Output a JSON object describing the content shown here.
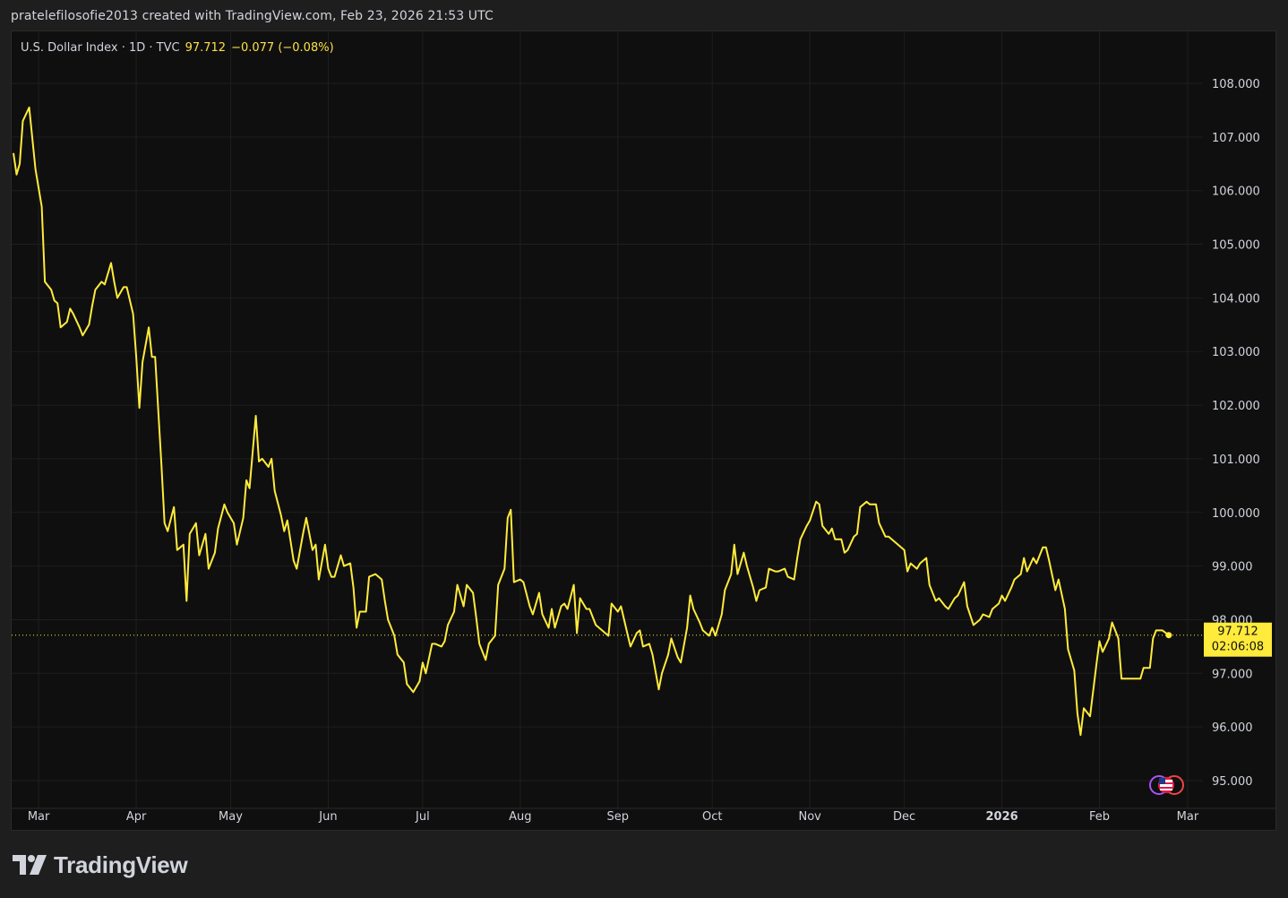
{
  "header": {
    "credit": "pratelefilosofie2013 created with TradingView.com, Feb 23, 2026 21:53 UTC"
  },
  "legend": {
    "symbol": "U.S. Dollar Index · 1D · TVC",
    "last": "97.712",
    "change": "−0.077 (−0.08%)"
  },
  "price_tag": {
    "price": "97.712",
    "countdown": "02:06:08"
  },
  "footer": {
    "brand": "TradingView"
  },
  "colors": {
    "line": "#ffeb3b",
    "background": "#0f0f0f",
    "grid": "#1f1f1f",
    "axis_text": "#d1d4dc"
  },
  "icons": [
    "us-flag-icon",
    "event-marker-icon"
  ],
  "chart_data": {
    "type": "line",
    "title": "U.S. Dollar Index · 1D · TVC",
    "xlabel": "",
    "ylabel": "",
    "ylim": [
      94.5,
      109.0
    ],
    "y_ticks": [
      "108.000",
      "107.000",
      "106.000",
      "105.000",
      "104.000",
      "103.000",
      "102.000",
      "101.000",
      "100.000",
      "99.000",
      "98.000",
      "97.000",
      "96.000",
      "95.000"
    ],
    "x_ticks": [
      "Mar",
      "Apr",
      "May",
      "Jun",
      "Jul",
      "Aug",
      "Sep",
      "Oct",
      "Nov",
      "Dec",
      "2026",
      "Feb",
      "Mar"
    ],
    "x_tick_dates": [
      "2025-03-01",
      "2025-04-01",
      "2025-05-01",
      "2025-06-01",
      "2025-07-01",
      "2025-08-01",
      "2025-09-01",
      "2025-10-01",
      "2025-11-01",
      "2025-12-01",
      "2026-01-01",
      "2026-02-01",
      "2026-03-01"
    ],
    "x_range": [
      "2025-02-21",
      "2026-03-05"
    ],
    "grid": true,
    "legend_position": "top-left",
    "last_value": 97.712,
    "series": [
      {
        "name": "U.S. Dollar Index",
        "points": [
          [
            "2025-02-21",
            106.7
          ],
          [
            "2025-02-22",
            106.3
          ],
          [
            "2025-02-23",
            106.5
          ],
          [
            "2025-02-24",
            107.3
          ],
          [
            "2025-02-26",
            107.55
          ],
          [
            "2025-02-28",
            106.4
          ],
          [
            "2025-03-02",
            105.7
          ],
          [
            "2025-03-03",
            104.3
          ],
          [
            "2025-03-05",
            104.15
          ],
          [
            "2025-03-06",
            103.95
          ],
          [
            "2025-03-07",
            103.9
          ],
          [
            "2025-03-08",
            103.45
          ],
          [
            "2025-03-10",
            103.55
          ],
          [
            "2025-03-11",
            103.8
          ],
          [
            "2025-03-12",
            103.7
          ],
          [
            "2025-03-14",
            103.45
          ],
          [
            "2025-03-15",
            103.3
          ],
          [
            "2025-03-17",
            103.5
          ],
          [
            "2025-03-18",
            103.85
          ],
          [
            "2025-03-19",
            104.15
          ],
          [
            "2025-03-21",
            104.3
          ],
          [
            "2025-03-22",
            104.25
          ],
          [
            "2025-03-24",
            104.65
          ],
          [
            "2025-03-25",
            104.3
          ],
          [
            "2025-03-26",
            104.0
          ],
          [
            "2025-03-28",
            104.2
          ],
          [
            "2025-03-29",
            104.2
          ],
          [
            "2025-03-31",
            103.7
          ],
          [
            "2025-04-01",
            102.9
          ],
          [
            "2025-04-02",
            101.95
          ],
          [
            "2025-04-03",
            102.8
          ],
          [
            "2025-04-05",
            103.45
          ],
          [
            "2025-04-06",
            102.9
          ],
          [
            "2025-04-07",
            102.9
          ],
          [
            "2025-04-09",
            100.9
          ],
          [
            "2025-04-10",
            99.8
          ],
          [
            "2025-04-11",
            99.65
          ],
          [
            "2025-04-13",
            100.1
          ],
          [
            "2025-04-14",
            99.3
          ],
          [
            "2025-04-16",
            99.4
          ],
          [
            "2025-04-17",
            98.35
          ],
          [
            "2025-04-18",
            99.6
          ],
          [
            "2025-04-20",
            99.8
          ],
          [
            "2025-04-21",
            99.2
          ],
          [
            "2025-04-23",
            99.6
          ],
          [
            "2025-04-24",
            98.95
          ],
          [
            "2025-04-26",
            99.25
          ],
          [
            "2025-04-27",
            99.7
          ],
          [
            "2025-04-29",
            100.15
          ],
          [
            "2025-04-30",
            100.0
          ],
          [
            "2025-05-02",
            99.8
          ],
          [
            "2025-05-03",
            99.4
          ],
          [
            "2025-05-05",
            99.9
          ],
          [
            "2025-05-06",
            100.6
          ],
          [
            "2025-05-07",
            100.45
          ],
          [
            "2025-05-09",
            101.8
          ],
          [
            "2025-05-10",
            100.95
          ],
          [
            "2025-05-11",
            101.0
          ],
          [
            "2025-05-13",
            100.85
          ],
          [
            "2025-05-14",
            101.0
          ],
          [
            "2025-05-15",
            100.4
          ],
          [
            "2025-05-17",
            99.95
          ],
          [
            "2025-05-18",
            99.65
          ],
          [
            "2025-05-19",
            99.85
          ],
          [
            "2025-05-21",
            99.1
          ],
          [
            "2025-05-22",
            98.95
          ],
          [
            "2025-05-24",
            99.6
          ],
          [
            "2025-05-25",
            99.9
          ],
          [
            "2025-05-27",
            99.3
          ],
          [
            "2025-05-28",
            99.4
          ],
          [
            "2025-05-29",
            98.75
          ],
          [
            "2025-05-31",
            99.4
          ],
          [
            "2025-06-01",
            98.95
          ],
          [
            "2025-06-02",
            98.8
          ],
          [
            "2025-06-03",
            98.8
          ],
          [
            "2025-06-05",
            99.2
          ],
          [
            "2025-06-06",
            99.0
          ],
          [
            "2025-06-08",
            99.05
          ],
          [
            "2025-06-09",
            98.6
          ],
          [
            "2025-06-10",
            97.85
          ],
          [
            "2025-06-11",
            98.15
          ],
          [
            "2025-06-13",
            98.15
          ],
          [
            "2025-06-14",
            98.8
          ],
          [
            "2025-06-16",
            98.85
          ],
          [
            "2025-06-18",
            98.75
          ],
          [
            "2025-06-19",
            98.35
          ],
          [
            "2025-06-20",
            98.0
          ],
          [
            "2025-06-22",
            97.7
          ],
          [
            "2025-06-23",
            97.35
          ],
          [
            "2025-06-25",
            97.2
          ],
          [
            "2025-06-26",
            96.8
          ],
          [
            "2025-06-28",
            96.65
          ],
          [
            "2025-06-30",
            96.85
          ],
          [
            "2025-07-01",
            97.2
          ],
          [
            "2025-07-02",
            97.0
          ],
          [
            "2025-07-04",
            97.55
          ],
          [
            "2025-07-05",
            97.55
          ],
          [
            "2025-07-07",
            97.5
          ],
          [
            "2025-07-08",
            97.6
          ],
          [
            "2025-07-09",
            97.9
          ],
          [
            "2025-07-11",
            98.15
          ],
          [
            "2025-07-12",
            98.65
          ],
          [
            "2025-07-14",
            98.25
          ],
          [
            "2025-07-15",
            98.65
          ],
          [
            "2025-07-17",
            98.5
          ],
          [
            "2025-07-18",
            98.05
          ],
          [
            "2025-07-19",
            97.55
          ],
          [
            "2025-07-21",
            97.25
          ],
          [
            "2025-07-22",
            97.55
          ],
          [
            "2025-07-24",
            97.7
          ],
          [
            "2025-07-25",
            98.65
          ],
          [
            "2025-07-27",
            98.95
          ],
          [
            "2025-07-28",
            99.9
          ],
          [
            "2025-07-29",
            100.05
          ],
          [
            "2025-07-30",
            98.7
          ],
          [
            "2025-08-01",
            98.75
          ],
          [
            "2025-08-02",
            98.7
          ],
          [
            "2025-08-04",
            98.25
          ],
          [
            "2025-08-05",
            98.1
          ],
          [
            "2025-08-07",
            98.5
          ],
          [
            "2025-08-08",
            98.1
          ],
          [
            "2025-08-10",
            97.85
          ],
          [
            "2025-08-11",
            98.2
          ],
          [
            "2025-08-12",
            97.85
          ],
          [
            "2025-08-14",
            98.25
          ],
          [
            "2025-08-15",
            98.3
          ],
          [
            "2025-08-16",
            98.2
          ],
          [
            "2025-08-18",
            98.65
          ],
          [
            "2025-08-19",
            97.75
          ],
          [
            "2025-08-20",
            98.4
          ],
          [
            "2025-08-22",
            98.2
          ],
          [
            "2025-08-23",
            98.2
          ],
          [
            "2025-08-25",
            97.9
          ],
          [
            "2025-08-26",
            97.85
          ],
          [
            "2025-08-28",
            97.75
          ],
          [
            "2025-08-29",
            97.7
          ],
          [
            "2025-08-30",
            98.3
          ],
          [
            "2025-09-01",
            98.15
          ],
          [
            "2025-09-02",
            98.25
          ],
          [
            "2025-09-04",
            97.75
          ],
          [
            "2025-09-05",
            97.5
          ],
          [
            "2025-09-07",
            97.75
          ],
          [
            "2025-09-08",
            97.8
          ],
          [
            "2025-09-09",
            97.5
          ],
          [
            "2025-09-11",
            97.55
          ],
          [
            "2025-09-12",
            97.35
          ],
          [
            "2025-09-14",
            96.7
          ],
          [
            "2025-09-15",
            97.0
          ],
          [
            "2025-09-17",
            97.35
          ],
          [
            "2025-09-18",
            97.65
          ],
          [
            "2025-09-20",
            97.3
          ],
          [
            "2025-09-21",
            97.2
          ],
          [
            "2025-09-23",
            97.85
          ],
          [
            "2025-09-24",
            98.45
          ],
          [
            "2025-09-25",
            98.2
          ],
          [
            "2025-09-27",
            97.95
          ],
          [
            "2025-09-28",
            97.8
          ],
          [
            "2025-09-30",
            97.7
          ],
          [
            "2025-10-01",
            97.85
          ],
          [
            "2025-10-02",
            97.7
          ],
          [
            "2025-10-04",
            98.1
          ],
          [
            "2025-10-05",
            98.55
          ],
          [
            "2025-10-07",
            98.85
          ],
          [
            "2025-10-08",
            99.4
          ],
          [
            "2025-10-09",
            98.85
          ],
          [
            "2025-10-11",
            99.25
          ],
          [
            "2025-10-12",
            99.0
          ],
          [
            "2025-10-14",
            98.6
          ],
          [
            "2025-10-15",
            98.35
          ],
          [
            "2025-10-16",
            98.55
          ],
          [
            "2025-10-18",
            98.6
          ],
          [
            "2025-10-19",
            98.95
          ],
          [
            "2025-10-21",
            98.9
          ],
          [
            "2025-10-22",
            98.9
          ],
          [
            "2025-10-24",
            98.95
          ],
          [
            "2025-10-25",
            98.8
          ],
          [
            "2025-10-27",
            98.75
          ],
          [
            "2025-10-28",
            99.15
          ],
          [
            "2025-10-29",
            99.5
          ],
          [
            "2025-10-31",
            99.75
          ],
          [
            "2025-11-01",
            99.85
          ],
          [
            "2025-11-03",
            100.2
          ],
          [
            "2025-11-04",
            100.15
          ],
          [
            "2025-11-05",
            99.75
          ],
          [
            "2025-11-07",
            99.6
          ],
          [
            "2025-11-08",
            99.7
          ],
          [
            "2025-11-09",
            99.5
          ],
          [
            "2025-11-11",
            99.5
          ],
          [
            "2025-11-12",
            99.25
          ],
          [
            "2025-11-13",
            99.3
          ],
          [
            "2025-11-15",
            99.55
          ],
          [
            "2025-11-16",
            99.6
          ],
          [
            "2025-11-17",
            100.1
          ],
          [
            "2025-11-19",
            100.2
          ],
          [
            "2025-11-20",
            100.15
          ],
          [
            "2025-11-22",
            100.15
          ],
          [
            "2025-11-23",
            99.8
          ],
          [
            "2025-11-25",
            99.55
          ],
          [
            "2025-11-26",
            99.55
          ],
          [
            "2025-11-28",
            99.45
          ],
          [
            "2025-11-29",
            99.4
          ],
          [
            "2025-12-01",
            99.3
          ],
          [
            "2025-12-02",
            98.9
          ],
          [
            "2025-12-03",
            99.05
          ],
          [
            "2025-12-05",
            98.95
          ],
          [
            "2025-12-06",
            99.05
          ],
          [
            "2025-12-08",
            99.15
          ],
          [
            "2025-12-09",
            98.65
          ],
          [
            "2025-12-11",
            98.35
          ],
          [
            "2025-12-12",
            98.4
          ],
          [
            "2025-12-14",
            98.25
          ],
          [
            "2025-12-15",
            98.2
          ],
          [
            "2025-12-17",
            98.4
          ],
          [
            "2025-12-18",
            98.45
          ],
          [
            "2025-12-20",
            98.7
          ],
          [
            "2025-12-21",
            98.25
          ],
          [
            "2025-12-23",
            97.9
          ],
          [
            "2025-12-25",
            98.0
          ],
          [
            "2025-12-26",
            98.1
          ],
          [
            "2025-12-28",
            98.05
          ],
          [
            "2025-12-29",
            98.2
          ],
          [
            "2025-12-31",
            98.3
          ],
          [
            "2026-01-01",
            98.45
          ],
          [
            "2026-01-02",
            98.35
          ],
          [
            "2026-01-04",
            98.6
          ],
          [
            "2026-01-05",
            98.75
          ],
          [
            "2026-01-07",
            98.85
          ],
          [
            "2026-01-08",
            99.15
          ],
          [
            "2026-01-09",
            98.9
          ],
          [
            "2026-01-11",
            99.15
          ],
          [
            "2026-01-12",
            99.05
          ],
          [
            "2026-01-14",
            99.35
          ],
          [
            "2026-01-15",
            99.35
          ],
          [
            "2026-01-16",
            99.1
          ],
          [
            "2026-01-18",
            98.55
          ],
          [
            "2026-01-19",
            98.75
          ],
          [
            "2026-01-21",
            98.2
          ],
          [
            "2026-01-22",
            97.45
          ],
          [
            "2026-01-24",
            97.05
          ],
          [
            "2026-01-25",
            96.25
          ],
          [
            "2026-01-26",
            95.85
          ],
          [
            "2026-01-27",
            96.35
          ],
          [
            "2026-01-29",
            96.2
          ],
          [
            "2026-01-31",
            97.15
          ],
          [
            "2026-02-01",
            97.6
          ],
          [
            "2026-02-02",
            97.4
          ],
          [
            "2026-02-04",
            97.65
          ],
          [
            "2026-02-05",
            97.95
          ],
          [
            "2026-02-07",
            97.65
          ],
          [
            "2026-02-08",
            96.9
          ],
          [
            "2026-02-09",
            96.9
          ],
          [
            "2026-02-11",
            96.9
          ],
          [
            "2026-02-13",
            96.9
          ],
          [
            "2026-02-14",
            96.9
          ],
          [
            "2026-02-15",
            97.1
          ],
          [
            "2026-02-17",
            97.1
          ],
          [
            "2026-02-18",
            97.65
          ],
          [
            "2026-02-19",
            97.8
          ],
          [
            "2026-02-21",
            97.8
          ],
          [
            "2026-02-23",
            97.712
          ]
        ]
      }
    ]
  }
}
